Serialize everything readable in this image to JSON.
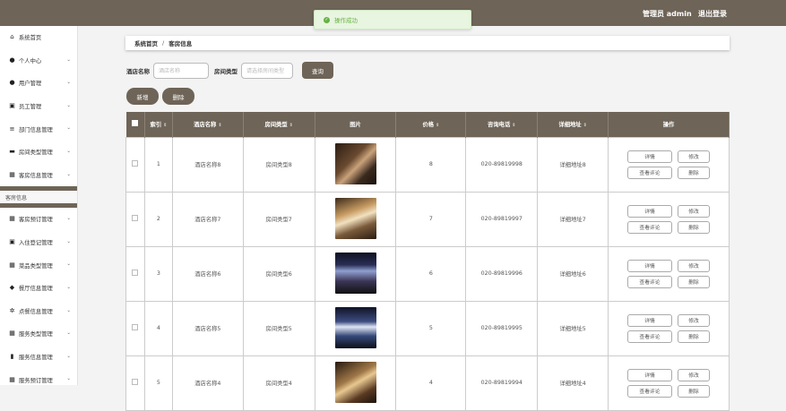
{
  "header": {
    "admin": "管理员 admin",
    "logout": "退出登录"
  },
  "toast": {
    "message": "操作成功"
  },
  "sidebar": {
    "items": [
      {
        "label": "系统首页",
        "icon": "home-icon",
        "glyph": "⌂"
      },
      {
        "label": "个人中心",
        "icon": "user-icon",
        "glyph": "●"
      },
      {
        "label": "用户管理",
        "icon": "user-icon",
        "glyph": "●"
      },
      {
        "label": "员工管理",
        "icon": "clipboard-icon",
        "glyph": "▣"
      },
      {
        "label": "部门信息管理",
        "icon": "list-icon",
        "glyph": "≡"
      },
      {
        "label": "房间类型管理",
        "icon": "bed-icon",
        "glyph": "▬"
      },
      {
        "label": "客房信息管理",
        "icon": "grid-icon",
        "glyph": "▦"
      }
    ],
    "submenu_label": "客房信息",
    "items_after": [
      {
        "label": "客房预订管理",
        "icon": "grid-icon",
        "glyph": "▦"
      },
      {
        "label": "入住登记管理",
        "icon": "clipboard-icon",
        "glyph": "▣"
      },
      {
        "label": "菜品类型管理",
        "icon": "grid-icon",
        "glyph": "▦"
      },
      {
        "label": "餐厅信息管理",
        "icon": "location-icon",
        "glyph": "◆"
      },
      {
        "label": "点餐信息管理",
        "icon": "settings-icon",
        "glyph": "✲"
      },
      {
        "label": "服务类型管理",
        "icon": "grid-icon",
        "glyph": "▦"
      },
      {
        "label": "服务信息管理",
        "icon": "chart-icon",
        "glyph": "▮"
      },
      {
        "label": "服务预订管理",
        "icon": "grid-icon",
        "glyph": "▦"
      }
    ]
  },
  "breadcrumb": {
    "home": "系统首页",
    "current": "客房信息"
  },
  "search": {
    "hotel_label": "酒店名称",
    "hotel_placeholder": "酒店名称",
    "type_label": "房间类型",
    "type_placeholder": "请选择房间类型",
    "query_button": "查询"
  },
  "actions": {
    "add": "新增",
    "delete": "删除"
  },
  "table": {
    "columns": [
      "索引",
      "酒店名称",
      "房间类型",
      "图片",
      "价格",
      "咨询电话",
      "详细地址",
      "操作"
    ],
    "sortable": [
      true,
      true,
      true,
      false,
      true,
      true,
      true,
      false
    ],
    "rows": [
      {
        "index": "1",
        "hotel": "酒店名称8",
        "type": "房间类型8",
        "price": "8",
        "phone": "020-89819998",
        "address": "详细地址8"
      },
      {
        "index": "2",
        "hotel": "酒店名称7",
        "type": "房间类型7",
        "price": "7",
        "phone": "020-89819997",
        "address": "详细地址7"
      },
      {
        "index": "3",
        "hotel": "酒店名称6",
        "type": "房间类型6",
        "price": "6",
        "phone": "020-89819996",
        "address": "详细地址6"
      },
      {
        "index": "4",
        "hotel": "酒店名称5",
        "type": "房间类型5",
        "price": "5",
        "phone": "020-89819995",
        "address": "详细地址5"
      },
      {
        "index": "5",
        "hotel": "酒店名称4",
        "type": "房间类型4",
        "price": "4",
        "phone": "020-89819994",
        "address": "详细地址4"
      }
    ],
    "row_actions": {
      "detail": "详情",
      "edit": "修改",
      "review": "查看评论",
      "delete": "删除"
    }
  },
  "colors": {
    "primary": "#6e6457",
    "success": "#67b144"
  }
}
